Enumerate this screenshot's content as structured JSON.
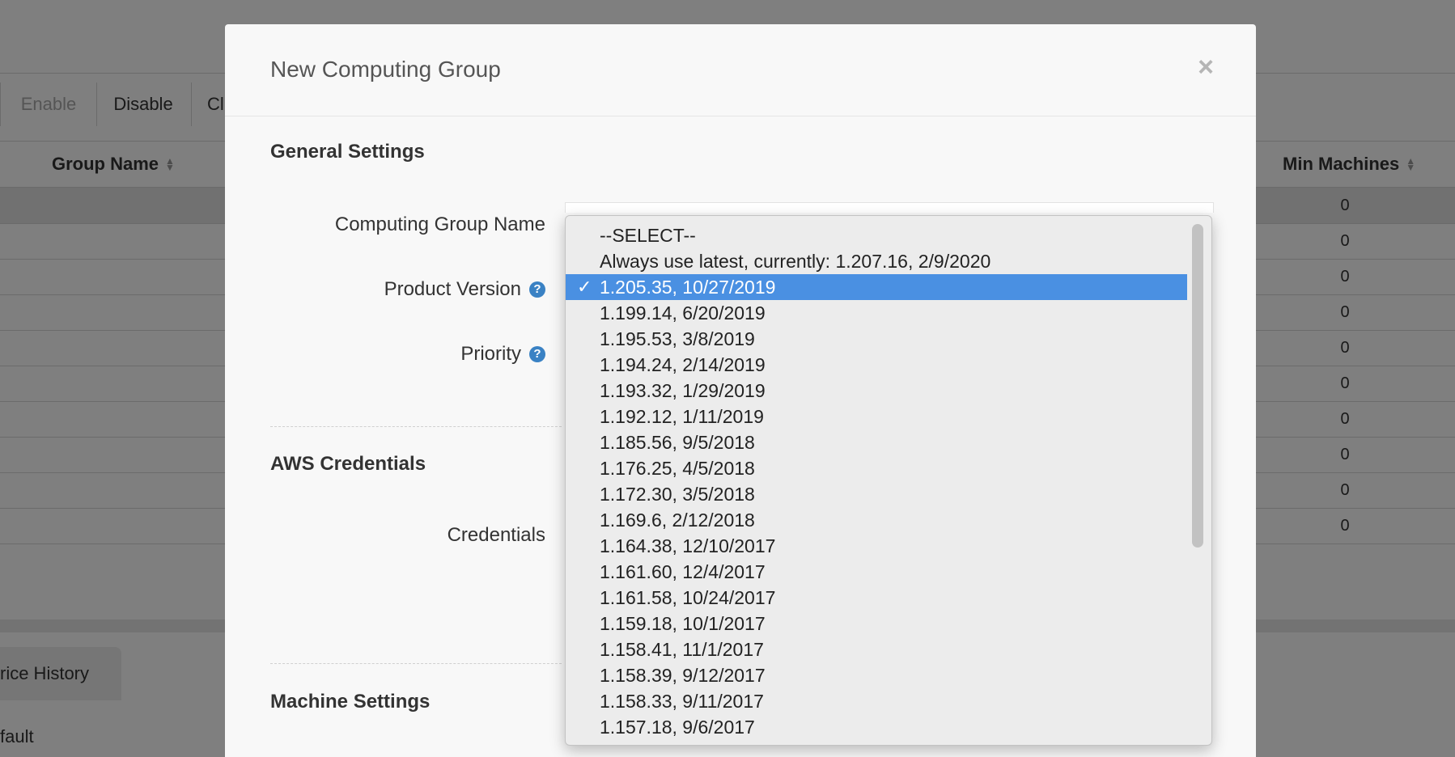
{
  "background": {
    "toolbar": {
      "enable": "Enable",
      "disable": "Disable",
      "clone_partial": "Cl"
    },
    "table": {
      "col_group_name": "Group Name",
      "col_min_machines": "Min Machines",
      "min_values": [
        "0",
        "0",
        "0",
        "0",
        "0",
        "0",
        "0",
        "0",
        "0",
        "0"
      ]
    },
    "tab_history_partial": "rice History",
    "default_partial": "fault"
  },
  "modal": {
    "title": "New Computing Group",
    "close": "×",
    "general_settings": "General Settings",
    "label_name": "Computing Group Name",
    "label_version": "Product Version",
    "label_priority": "Priority",
    "help_glyph": "?",
    "aws_credentials": "AWS Credentials",
    "label_credentials": "Credentials",
    "machine_settings": "Machine Settings"
  },
  "dropdown": {
    "check_glyph": "✓",
    "selected_index": 2,
    "options": [
      "--SELECT--",
      "Always use latest, currently: 1.207.16, 2/9/2020",
      "1.205.35, 10/27/2019",
      "1.199.14, 6/20/2019",
      "1.195.53, 3/8/2019",
      "1.194.24, 2/14/2019",
      "1.193.32, 1/29/2019",
      "1.192.12, 1/11/2019",
      "1.185.56, 9/5/2018",
      "1.176.25, 4/5/2018",
      "1.172.30, 3/5/2018",
      "1.169.6, 2/12/2018",
      "1.164.38, 12/10/2017",
      "1.161.60, 12/4/2017",
      "1.161.58, 10/24/2017",
      "1.159.18, 10/1/2017",
      "1.158.41, 11/1/2017",
      "1.158.39, 9/12/2017",
      "1.158.33, 9/11/2017",
      "1.157.18, 9/6/2017"
    ]
  }
}
